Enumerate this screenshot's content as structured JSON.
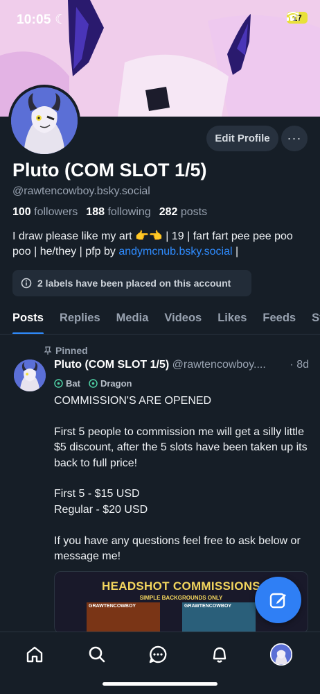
{
  "status_bar": {
    "time": "10:05",
    "battery": "17"
  },
  "profile": {
    "display_name": "Pluto (COM SLOT 1/5)",
    "handle": "@rawtencowboy.bsky.social",
    "edit_button": "Edit Profile",
    "more_button": "···",
    "stats": {
      "followers_count": "100",
      "followers_label": "followers",
      "following_count": "188",
      "following_label": "following",
      "posts_count": "282",
      "posts_label": "posts"
    },
    "bio_text": "I draw please like my art 👉👈 | 19 | fart fart pee pee poo poo | he/they | pfp by ",
    "bio_link": "andymcnub.bsky.social",
    "bio_end": " |",
    "labels_notice": "2 labels have been placed on this account"
  },
  "tabs": [
    "Posts",
    "Replies",
    "Media",
    "Videos",
    "Likes",
    "Feeds",
    "Starter Packs"
  ],
  "active_tab": "Posts",
  "post": {
    "pinned_label": "Pinned",
    "author_name": "Pluto (COM SLOT 1/5)",
    "author_handle": "@rawtencowboy....",
    "separator": "·",
    "time": "8d",
    "tags": [
      "Bat",
      "Dragon"
    ],
    "body": "COMMISSION'S ARE OPENED\n\nFirst 5 people to commission me will get a silly little $5 discount, after the 5 slots have been taken up its back to full price!\n\nFirst 5 - $15 USD\nRegular - $20 USD\n\nIf you have any questions feel free to ask below or message me!",
    "image": {
      "title": "HEADSHOT COMMISSIONS",
      "subtitle": "SIMPLE BACKGROUNDS ONLY",
      "panel_label_1": "GRAWTENCOWBOY",
      "panel_label_2": "GRAWTENCOWBOY"
    }
  },
  "nav": [
    "home-icon",
    "search-icon",
    "chat-icon",
    "bell-icon",
    "profile-avatar"
  ],
  "colors": {
    "accent": "#2f8cff",
    "background": "#161e27",
    "fab": "#2f7ff5"
  }
}
